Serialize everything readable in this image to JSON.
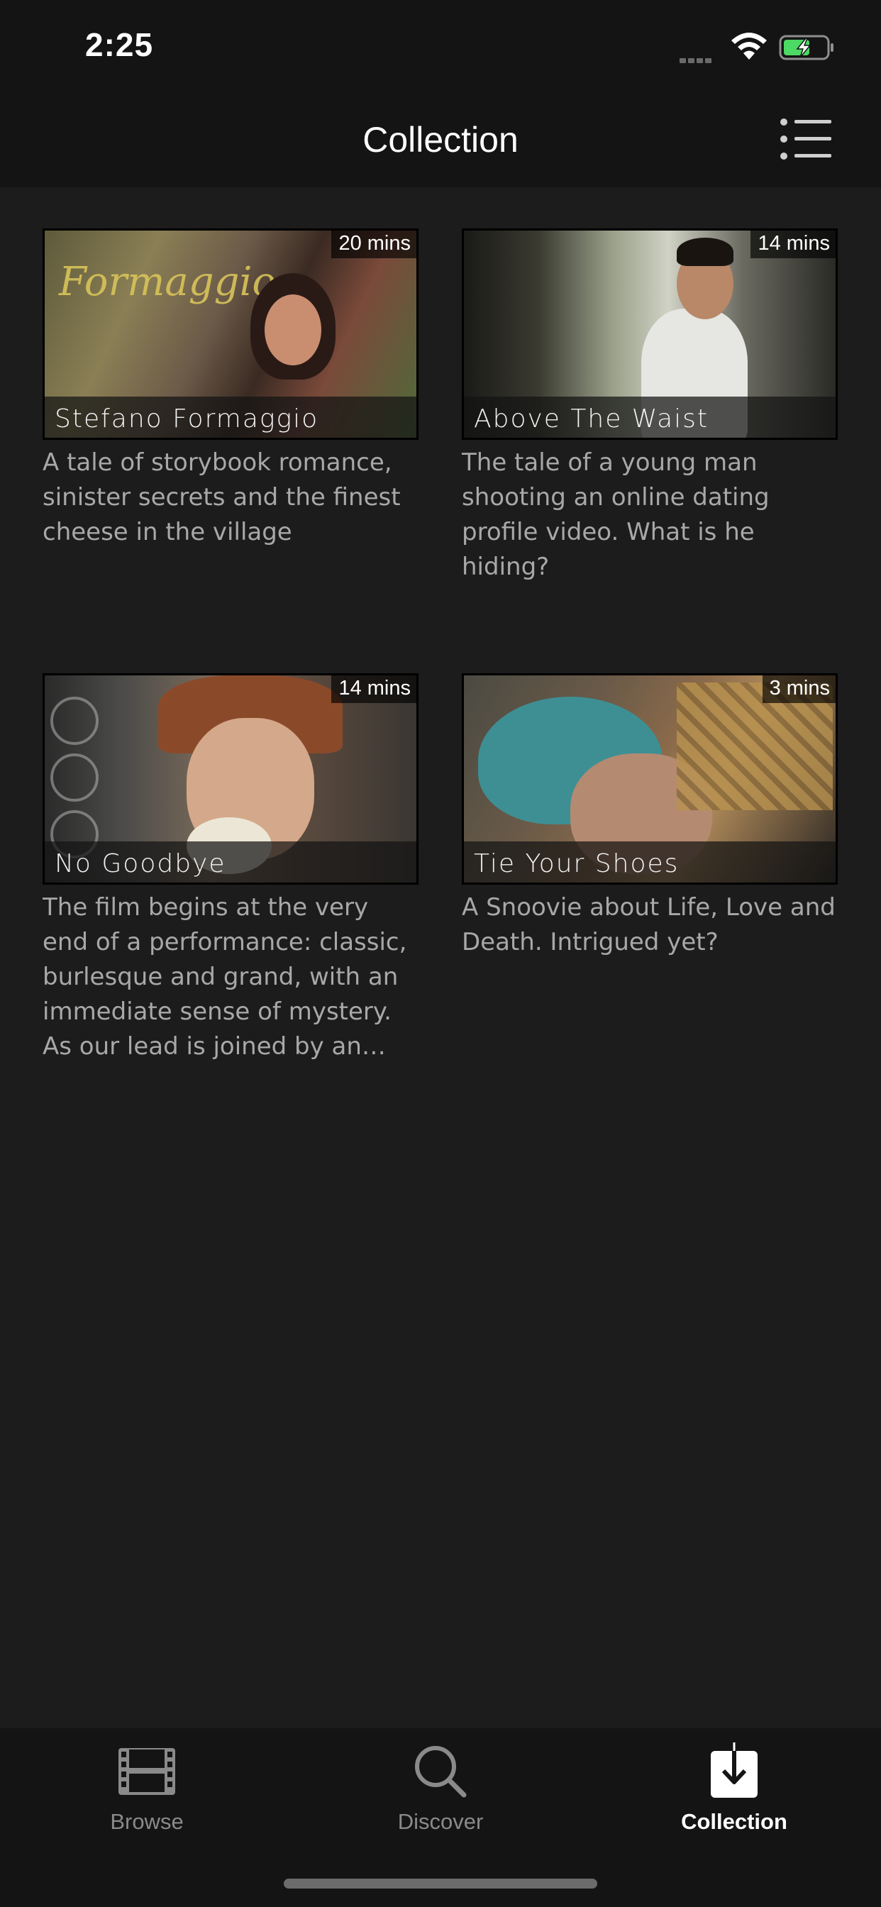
{
  "status_bar": {
    "time": "2:25",
    "icons": [
      "signal-icon",
      "wifi-icon",
      "battery-charging-icon"
    ],
    "battery_color": "#4cd964"
  },
  "header": {
    "title": "Collection",
    "menu_icon": "list-icon"
  },
  "films": [
    {
      "title": "Stefano Formaggio",
      "duration": "20 mins",
      "description": "A tale of storybook romance, sinister secrets and the finest cheese in the village"
    },
    {
      "title": "Above The Waist",
      "duration": "14 mins",
      "description": "The tale of a young man shooting an online dating profile video. What is he hiding?"
    },
    {
      "title": "No Goodbye",
      "duration": "14 mins",
      "description": "The film begins at the very end of a performance: classic, burlesque and grand, with an immediate sense of mystery. As our lead is joined by an un..."
    },
    {
      "title": "Tie Your Shoes",
      "duration": "3 mins",
      "description": "A Snoovie about Life, Love and Death. Intrigued yet?"
    }
  ],
  "tabs": [
    {
      "label": "Browse",
      "icon": "film-icon",
      "active": false
    },
    {
      "label": "Discover",
      "icon": "search-icon",
      "active": false
    },
    {
      "label": "Collection",
      "icon": "download-icon",
      "active": true
    }
  ],
  "colors": {
    "background": "#1c1c1c",
    "bar_background": "#141414",
    "tab_inactive": "#8a8a8a",
    "tab_active": "#ffffff",
    "description_text": "#a8a8a8"
  }
}
